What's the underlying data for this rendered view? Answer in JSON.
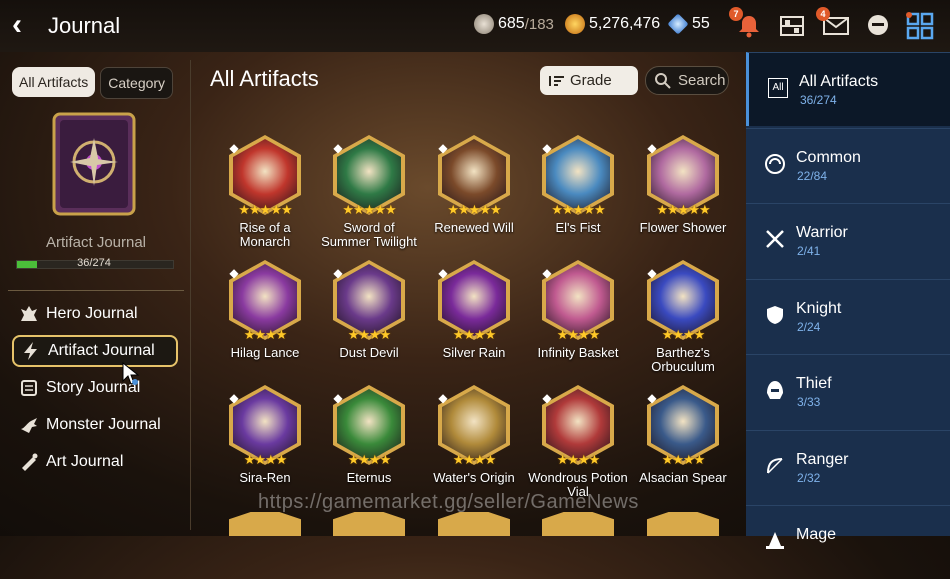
{
  "header": {
    "back_icon": "chevron-left-icon",
    "title": "Journal",
    "resources": [
      {
        "icon": "stamina-leaf-icon",
        "value": "685",
        "max": "/183",
        "color": "#c9c2b6"
      },
      {
        "icon": "gold-coin-icon",
        "value": "5,276,476",
        "color": "#f0a020"
      },
      {
        "icon": "crystal-icon",
        "value": "55",
        "color": "#7fb8f0"
      }
    ],
    "icons": [
      {
        "name": "notification-bell-icon",
        "badge": "7"
      },
      {
        "name": "inventory-rack-icon",
        "badge": ""
      },
      {
        "name": "mail-icon",
        "badge": "4"
      },
      {
        "name": "chat-icon",
        "badge": ""
      },
      {
        "name": "menu-grid-icon",
        "badge": ""
      }
    ]
  },
  "left": {
    "tabs": [
      {
        "label": "All Artifacts",
        "active": true
      },
      {
        "label": "Category",
        "active": false
      }
    ],
    "book_label": "Artifact Journal",
    "progress": {
      "current": 36,
      "total": 274,
      "text": "36/274",
      "fraction": 0.131
    },
    "nav": [
      {
        "label": "Hero Journal",
        "icon": "hero-journal-icon",
        "selected": false
      },
      {
        "label": "Artifact Journal",
        "icon": "lightning-icon",
        "selected": true
      },
      {
        "label": "Story Journal",
        "icon": "scroll-icon",
        "selected": false
      },
      {
        "label": "Monster Journal",
        "icon": "dragon-icon",
        "selected": false
      },
      {
        "label": "Art Journal",
        "icon": "palette-icon",
        "selected": false
      }
    ]
  },
  "main": {
    "title": "All Artifacts",
    "sort_label": "Grade",
    "search_label": "Search",
    "artifacts": [
      {
        "name": "Rise of a Monarch",
        "stars": "★★★★★",
        "cls": "knight",
        "color": "#c0362c"
      },
      {
        "name": "Sword of Summer Twilight",
        "stars": "★★★★★",
        "cls": "thief",
        "color": "#2f7a46"
      },
      {
        "name": "Renewed Will",
        "stars": "★★★★★",
        "cls": "ranger",
        "color": "#7b4a2a"
      },
      {
        "name": "El's Fist",
        "stars": "★★★★★",
        "cls": "warrior",
        "color": "#4a8ac0"
      },
      {
        "name": "Flower Shower",
        "stars": "★★★★★",
        "cls": "common",
        "color": "#b06aa0"
      },
      {
        "name": "Hilag Lance",
        "stars": "★★★★",
        "cls": "knight",
        "color": "#8a3aa0"
      },
      {
        "name": "Dust Devil",
        "stars": "★★★★",
        "cls": "thief",
        "color": "#6a3a8a"
      },
      {
        "name": "Silver Rain",
        "stars": "★★★★",
        "cls": "thief",
        "color": "#7a2a9a"
      },
      {
        "name": "Infinity Basket",
        "stars": "★★★★",
        "cls": "ranger",
        "color": "#c05a90"
      },
      {
        "name": "Barthez's Orbuculum",
        "stars": "★★★★",
        "cls": "mage",
        "color": "#3a4ac0"
      },
      {
        "name": "Sira-Ren",
        "stars": "★★★★",
        "cls": "mage",
        "color": "#6a3aa0"
      },
      {
        "name": "Eternus",
        "stars": "★★★★",
        "cls": "soul-weaver",
        "color": "#3a8a3a"
      },
      {
        "name": "Water's Origin",
        "stars": "★★★★",
        "cls": "soul-weaver",
        "color": "#b08a3a"
      },
      {
        "name": "Wondrous Potion Vial",
        "stars": "★★★★",
        "cls": "soul-weaver",
        "color": "#b03a3a"
      },
      {
        "name": "Alsacian Spear",
        "stars": "★★★★",
        "cls": "knight",
        "color": "#3a5a8a"
      }
    ]
  },
  "watermark": "https://gamemarket.gg/seller/GameNews",
  "categories": [
    {
      "label": "All Artifacts",
      "count": "36/274",
      "icon": "all-icon",
      "selected": true
    },
    {
      "label": "Common",
      "count": "22/84",
      "icon": "common-swirl-icon",
      "selected": false
    },
    {
      "label": "Warrior",
      "count": "2/41",
      "icon": "warrior-swords-icon",
      "selected": false
    },
    {
      "label": "Knight",
      "count": "2/24",
      "icon": "knight-shield-icon",
      "selected": false
    },
    {
      "label": "Thief",
      "count": "3/33",
      "icon": "thief-hood-icon",
      "selected": false
    },
    {
      "label": "Ranger",
      "count": "2/32",
      "icon": "ranger-bow-icon",
      "selected": false
    },
    {
      "label": "Mage",
      "count": "",
      "icon": "mage-hat-icon",
      "selected": false
    }
  ]
}
